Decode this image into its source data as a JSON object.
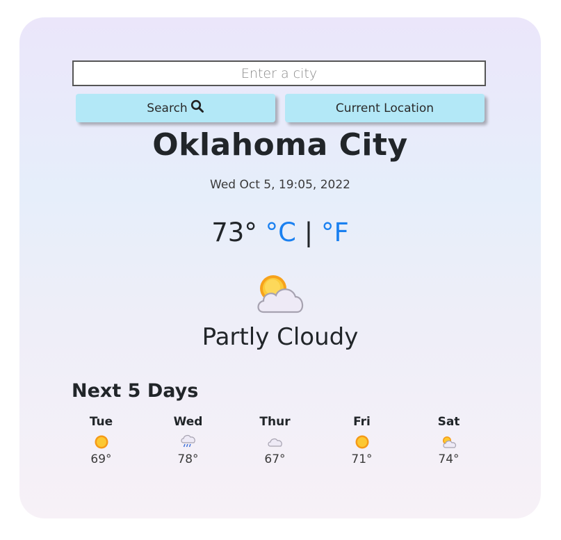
{
  "search": {
    "placeholder": "Enter a city",
    "search_label": "Search",
    "location_label": "Current Location"
  },
  "current": {
    "city": "Oklahoma City",
    "date": "Wed Oct 5, 19:05, 2022",
    "temperature": "73",
    "degree": "°",
    "unit_c": "°C",
    "separator": "|",
    "unit_f": "°F",
    "description": "Partly Cloudy",
    "icon": "partly-cloudy-icon"
  },
  "forecast": {
    "title": "Next 5 Days",
    "days": [
      {
        "name": "Tue",
        "temp": "69°",
        "icon": "sun-icon"
      },
      {
        "name": "Wed",
        "temp": "78°",
        "icon": "rain-icon"
      },
      {
        "name": "Thur",
        "temp": "67°",
        "icon": "cloud-icon"
      },
      {
        "name": "Fri",
        "temp": "71°",
        "icon": "sun-icon"
      },
      {
        "name": "Sat",
        "temp": "74°",
        "icon": "partly-cloudy-icon"
      }
    ]
  },
  "colors": {
    "button_bg": "#b3e8f7",
    "unit_link": "#1a80f0",
    "sun": "#f7a21b",
    "cloud": "#eeeaf6"
  }
}
